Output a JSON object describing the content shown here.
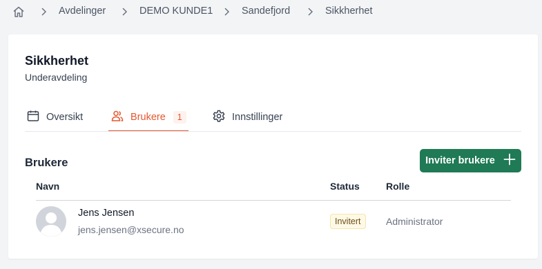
{
  "breadcrumb": {
    "home_icon": "home-icon",
    "items": [
      "Avdelinger",
      "DEMO KUNDE1",
      "Sandefjord",
      "Sikkherhet"
    ]
  },
  "page": {
    "title": "Sikkherhet",
    "subtitle": "Underavdeling"
  },
  "tabs": [
    {
      "label": "Oversikt",
      "icon": "calendar-icon",
      "active": false
    },
    {
      "label": "Brukere",
      "icon": "users-icon",
      "active": true,
      "badge": "1"
    },
    {
      "label": "Innstillinger",
      "icon": "gear-icon",
      "active": false
    }
  ],
  "section": {
    "title": "Brukere",
    "invite_button": "Inviter brukere"
  },
  "table": {
    "headers": {
      "name": "Navn",
      "status": "Status",
      "role": "Rolle"
    },
    "rows": [
      {
        "name": "Jens Jensen",
        "email": "jens.jensen@xsecure.no",
        "status": "Invitert",
        "role": "Administrator"
      }
    ]
  },
  "colors": {
    "accent": "#e4572e",
    "primary_button": "#1f7a55",
    "status_invited_bg": "#fef9e7"
  }
}
